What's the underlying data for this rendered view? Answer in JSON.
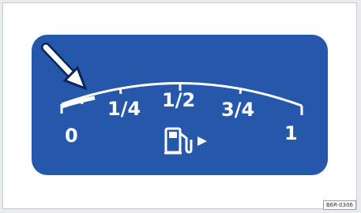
{
  "gauge": {
    "title": "",
    "marks": [
      "0",
      "1/4",
      "1/2",
      "3/4",
      "1"
    ],
    "fuel_level_fraction": 0.12,
    "pointer": "arrow pointing to low fuel segment",
    "icon": "fuel-pump-icon",
    "tank_side_indicator": "right-triangle-icon"
  },
  "figure_code": "B6R-0306",
  "colors": {
    "panel": "#2558ab",
    "markings": "#ffffff",
    "page": "#ffffff"
  }
}
